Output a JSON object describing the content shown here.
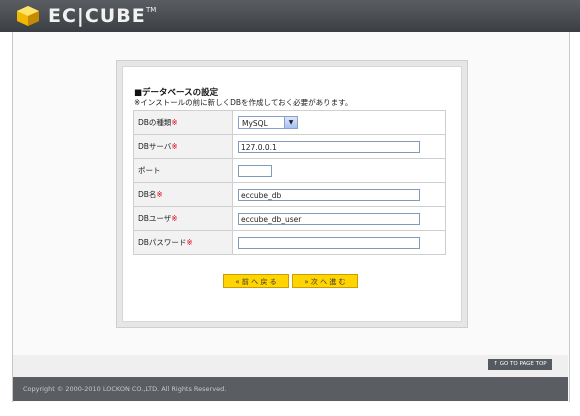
{
  "header": {
    "logo_text": "EC|CUBE",
    "logo_tm": "TM"
  },
  "section": {
    "title": "■データベースの設定",
    "note": "※インストールの前に新しくDBを作成しておく必要があります。"
  },
  "form": {
    "required_mark": "※",
    "db_type_label": "DBの種類",
    "db_type_value": "MySQL",
    "db_server_label": "DBサーバ",
    "db_server_value": "127.0.0.1",
    "port_label": "ポート",
    "port_value": "",
    "db_name_label": "DB名",
    "db_name_value": "eccube_db",
    "db_user_label": "DBユーザ",
    "db_user_value": "eccube_db_user",
    "db_password_label": "DBパスワード",
    "db_password_value": ""
  },
  "buttons": {
    "back": "« 前 へ 戻 る",
    "next": "» 次 へ 進 む"
  },
  "pagetop": "↑ GO TO PAGE TOP",
  "footer": {
    "copyright": "Copyright © 2000-2010 LOCKON CO.,LTD. All Rights Reserved."
  },
  "colors": {
    "header": "#4b4e53",
    "required": "#e0001b",
    "button": "#ffd400"
  },
  "icons": {
    "logo": "cube-logo-icon",
    "select_arrow": "chevron-down-icon"
  }
}
